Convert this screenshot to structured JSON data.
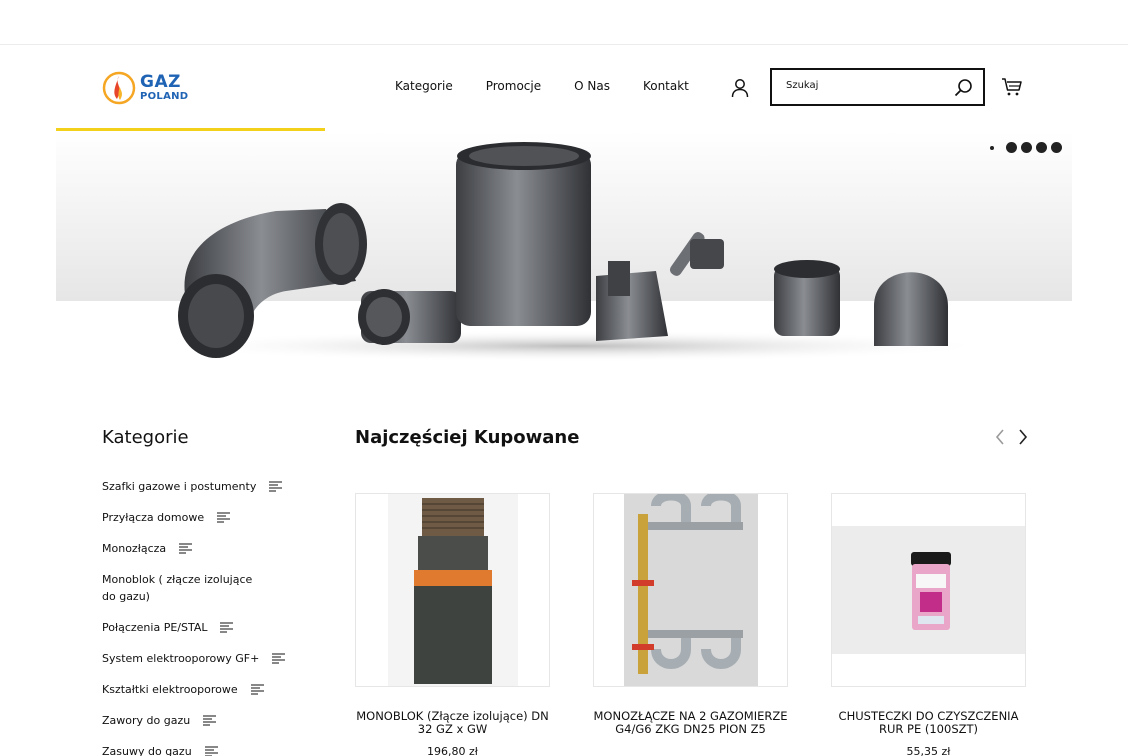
{
  "header": {
    "logo": {
      "line1": "GAZ",
      "line2": "POLAND"
    },
    "nav": [
      "Kategorie",
      "Promocje",
      "O Nas",
      "Kontakt"
    ],
    "search": {
      "placeholder": "Szukaj"
    },
    "icons": [
      "user-icon",
      "search-icon",
      "cart-icon"
    ]
  },
  "hero": {
    "slides_total": 5,
    "active_slide": 1
  },
  "sidebar": {
    "title": "Kategorie",
    "items": [
      {
        "label": "Szafki gazowe i postumenty",
        "has_submenu": true
      },
      {
        "label": "Przyłącza domowe",
        "has_submenu": true
      },
      {
        "label": "Monozłącza",
        "has_submenu": true
      },
      {
        "label": "Monoblok ( złącze izolujące do gazu)",
        "has_submenu": false
      },
      {
        "label": "Połączenia PE/STAL",
        "has_submenu": true
      },
      {
        "label": "System elektrooporowy GF+",
        "has_submenu": true
      },
      {
        "label": "Kształtki elektrooporowe",
        "has_submenu": true
      },
      {
        "label": "Zawory do gazu",
        "has_submenu": true
      },
      {
        "label": "Zasuwy do gazu",
        "has_submenu": true
      }
    ]
  },
  "products": {
    "title": "Najczęściej Kupowane",
    "items": [
      {
        "name": "MONOBLOK (Złącze izolujące) DN 32 GZ x GW",
        "price": "196,80 zł"
      },
      {
        "name": "MONOZŁĄCZE NA 2 GAZOMIERZE G4/G6 ZKG DN25 PION Z5",
        "price": ""
      },
      {
        "name": "CHUSTECZKI DO CZYSZCZENIA RUR PE (100SZT)",
        "price": "55,35 zł"
      }
    ]
  },
  "colors": {
    "accent_yellow": "#f3d11a",
    "logo_blue": "#1f63b4",
    "text": "#111111"
  }
}
